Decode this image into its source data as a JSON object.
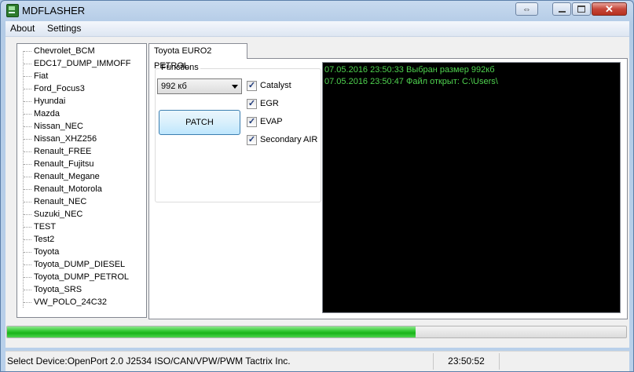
{
  "window": {
    "title": "MDFLASHER"
  },
  "menu": [
    {
      "label": "About"
    },
    {
      "label": "Settings"
    }
  ],
  "device_tree": [
    "Chevrolet_BCM",
    "EDC17_DUMP_IMMOFF",
    "Fiat",
    "Ford_Focus3",
    "Hyundai",
    "Mazda",
    "Nissan_NEC",
    "Nissan_XHZ256",
    "Renault_FREE",
    "Renault_Fujitsu",
    "Renault_Megane",
    "Renault_Motorola",
    "Renault_NEC",
    "Suzuki_NEC",
    "TEST",
    "Test2",
    "Toyota",
    "Toyota_DUMP_DIESEL",
    "Toyota_DUMP_PETROL",
    "Toyota_SRS",
    "VW_POLO_24C32"
  ],
  "tab": {
    "label": "Toyota EURO2 PETROL"
  },
  "functions": {
    "group_label": "Functions",
    "size_select": "992 кб",
    "patch_label": "PATCH",
    "checkboxes": [
      {
        "label": "Catalyst",
        "checked": true
      },
      {
        "label": "EGR",
        "checked": true
      },
      {
        "label": "EVAP",
        "checked": true
      },
      {
        "label": "Secondary AIR",
        "checked": true
      }
    ]
  },
  "log": [
    "07.05.2016 23:50:33 Выбран размер 992кб",
    "07.05.2016 23:50:47 Файл открыт: C:\\Users\\"
  ],
  "progress": {
    "fraction": 0.66
  },
  "status": {
    "device": "Select Device:OpenPort 2.0 J2534 ISO/CAN/VPW/PWM  Tactrix Inc.",
    "time": "23:50:52"
  },
  "colors": {
    "log_text": "#4fd34f",
    "progress_fill": "#22bb22",
    "close_button": "#c5473a"
  }
}
